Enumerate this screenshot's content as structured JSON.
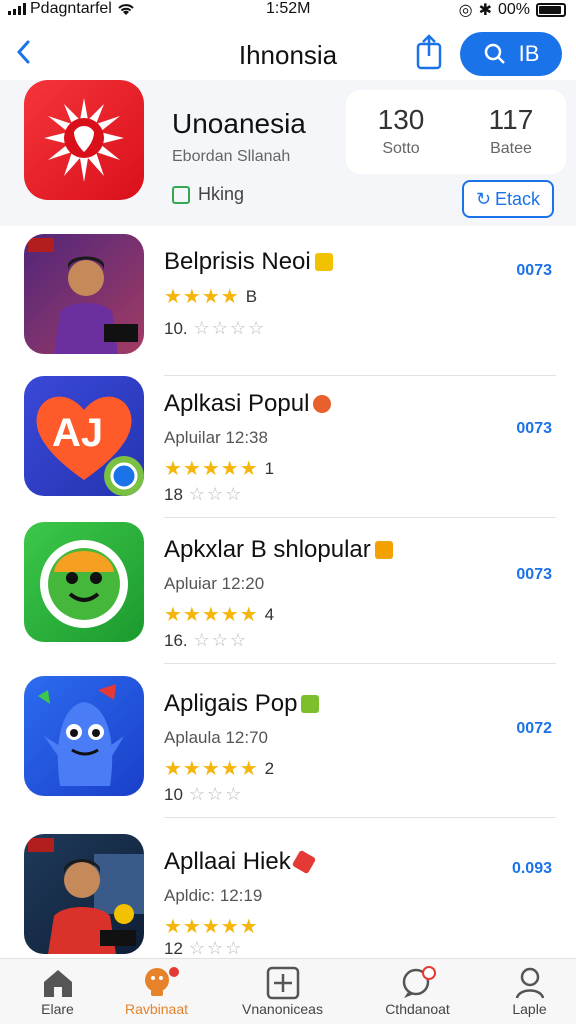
{
  "status_bar": {
    "carrier": "Pdagntarfel",
    "time": "1:52M",
    "battery_text": "00%",
    "battery_level": 0.9
  },
  "header": {
    "title": "Ihnonsia",
    "search_label": "IB"
  },
  "featured_app": {
    "name": "Unoanesia",
    "subtitle": "Ebordan Sllanah",
    "checkbox_label": "Hking",
    "stats": [
      {
        "value": "130",
        "label": "Sotto"
      },
      {
        "value": "117",
        "label": "Batee"
      }
    ],
    "action_label": "Etack"
  },
  "apps": [
    {
      "name": "Belprisis Neoi",
      "meta": "",
      "rating_value": "B",
      "reviews": "10.",
      "price": "0073",
      "tag_color": "#f2c200"
    },
    {
      "name": "Aplkasi Popul",
      "meta": "Apluilar 12:38",
      "rating_value": "1",
      "reviews": "18",
      "price": "0073",
      "tag_color": "#e8602c"
    },
    {
      "name": "Apkxlar B shlopular",
      "meta": "Apluiar  12:20",
      "rating_value": "4",
      "reviews": "16.",
      "price": "0073",
      "tag_color": "#f2a100"
    },
    {
      "name": "Apligais Pop",
      "meta": "Aplaula 12:70",
      "rating_value": "2",
      "reviews": "10",
      "price": "0072",
      "tag_color": "#7cbf2a"
    },
    {
      "name": "Apllaai Hiek",
      "meta": "Apldic: 12:19",
      "rating_value": "",
      "reviews": "12",
      "price": "0.093",
      "tag_color": "#e53935"
    }
  ],
  "bottom_nav": [
    {
      "label": "Elare",
      "icon": "home-icon"
    },
    {
      "label": "Ravbinaat",
      "icon": "bulb-icon"
    },
    {
      "label": "Vnanoniceas",
      "icon": "plus-square-icon"
    },
    {
      "label": "Cthdanoat",
      "icon": "chat-icon"
    },
    {
      "label": "Laple",
      "icon": "person-icon"
    }
  ],
  "colors": {
    "accent": "#1a73e8",
    "active_tab": "#e5822a",
    "star": "#f5b50a"
  }
}
